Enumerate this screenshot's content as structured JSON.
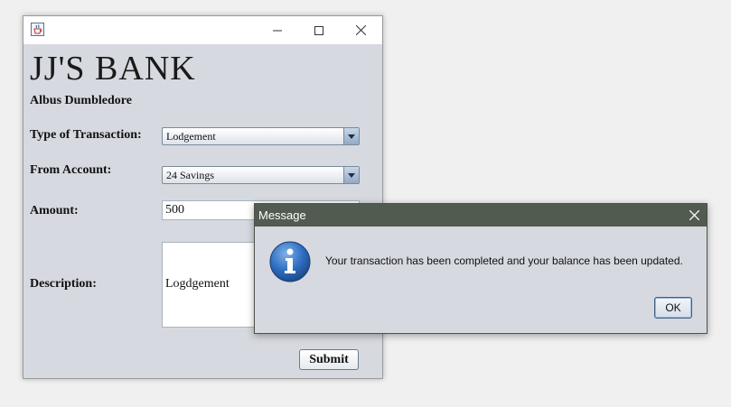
{
  "window": {
    "minimize_icon": "minimize-icon",
    "maximize_icon": "maximize-icon",
    "close_icon": "close-icon",
    "app_icon": "java-cup-icon"
  },
  "bank": {
    "title": "JJ'S BANK",
    "user_name": "Albus Dumbledore"
  },
  "form": {
    "transaction_type_label": "Type of Transaction:",
    "transaction_type_value": "Lodgement",
    "from_account_label": "From Account:",
    "from_account_value": "24 Savings",
    "amount_label": "Amount:",
    "amount_value": "500",
    "description_label": "Description:",
    "description_value": "Logdgement",
    "submit_label": "Submit"
  },
  "dialog": {
    "title": "Message",
    "message": "Your transaction has been completed and your balance has been updated.",
    "ok_label": "OK",
    "icon": "info-icon"
  },
  "colors": {
    "window_bg": "#d6d9df",
    "dialog_titlebar": "#525b4f"
  }
}
